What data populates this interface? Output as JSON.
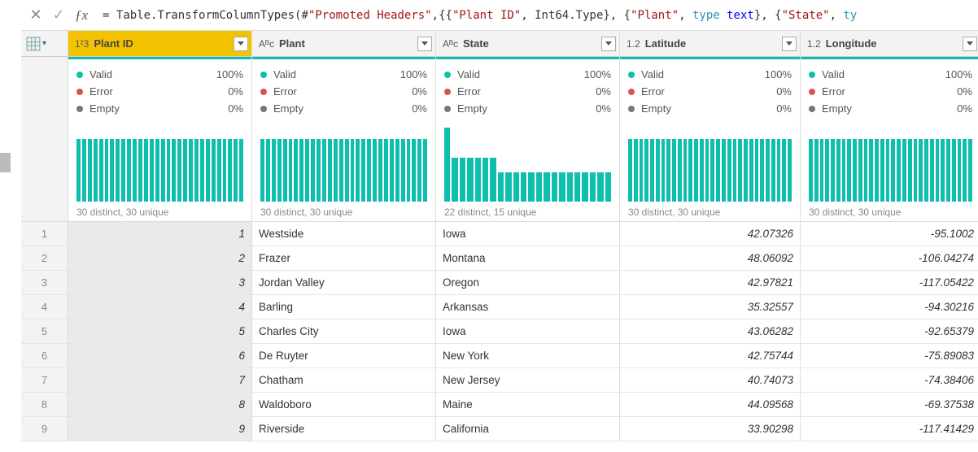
{
  "formula": {
    "prefix": "= ",
    "parts": [
      {
        "t": "plain",
        "v": "Table.TransformColumnTypes(#"
      },
      {
        "t": "str",
        "v": "\"Promoted Headers\""
      },
      {
        "t": "plain",
        "v": ",{{"
      },
      {
        "t": "str",
        "v": "\"Plant ID\""
      },
      {
        "t": "plain",
        "v": ", Int64.Type}, {"
      },
      {
        "t": "str",
        "v": "\"Plant\""
      },
      {
        "t": "plain",
        "v": ", "
      },
      {
        "t": "kw",
        "v": "type"
      },
      {
        "t": "plain",
        "v": " "
      },
      {
        "t": "type",
        "v": "text"
      },
      {
        "t": "plain",
        "v": "}, {"
      },
      {
        "t": "str",
        "v": "\"State\""
      },
      {
        "t": "plain",
        "v": ", "
      },
      {
        "t": "kw",
        "v": "ty"
      }
    ]
  },
  "stats": {
    "valid_label": "Valid",
    "error_label": "Error",
    "empty_label": "Empty",
    "pct100": "100%",
    "pct0": "0%"
  },
  "columns": [
    {
      "name": "Plant ID",
      "type_icon": "1²3",
      "selected": true,
      "align": "num",
      "dist_label": "30 distinct, 30 unique",
      "bars": "flat"
    },
    {
      "name": "Plant",
      "type_icon": "Aᴮc",
      "selected": false,
      "align": "text",
      "dist_label": "30 distinct, 30 unique",
      "bars": "flat"
    },
    {
      "name": "State",
      "type_icon": "Aᴮc",
      "selected": false,
      "align": "text",
      "dist_label": "22 distinct, 15 unique",
      "bars": "stepped"
    },
    {
      "name": "Latitude",
      "type_icon": "1.2",
      "selected": false,
      "align": "num",
      "dist_label": "30 distinct, 30 unique",
      "bars": "flat"
    },
    {
      "name": "Longitude",
      "type_icon": "1.2",
      "selected": false,
      "align": "num",
      "dist_label": "30 distinct, 30 unique",
      "bars": "flat"
    }
  ],
  "rows": [
    {
      "idx": "1",
      "cells": [
        "1",
        "Westside",
        "Iowa",
        "42.07326",
        "-95.1002"
      ]
    },
    {
      "idx": "2",
      "cells": [
        "2",
        "Frazer",
        "Montana",
        "48.06092",
        "-106.04274"
      ]
    },
    {
      "idx": "3",
      "cells": [
        "3",
        "Jordan Valley",
        "Oregon",
        "42.97821",
        "-117.05422"
      ]
    },
    {
      "idx": "4",
      "cells": [
        "4",
        "Barling",
        "Arkansas",
        "35.32557",
        "-94.30216"
      ]
    },
    {
      "idx": "5",
      "cells": [
        "5",
        "Charles City",
        "Iowa",
        "43.06282",
        "-92.65379"
      ]
    },
    {
      "idx": "6",
      "cells": [
        "6",
        "De Ruyter",
        "New York",
        "42.75744",
        "-75.89083"
      ]
    },
    {
      "idx": "7",
      "cells": [
        "7",
        "Chatham",
        "New Jersey",
        "40.74073",
        "-74.38406"
      ]
    },
    {
      "idx": "8",
      "cells": [
        "8",
        "Waldoboro",
        "Maine",
        "44.09568",
        "-69.37538"
      ]
    },
    {
      "idx": "9",
      "cells": [
        "9",
        "Riverside",
        "California",
        "33.90298",
        "-117.41429"
      ]
    }
  ],
  "chart_data": {
    "type": "table",
    "title": "Power Query Preview",
    "columns": [
      "Plant ID",
      "Plant",
      "State",
      "Latitude",
      "Longitude"
    ],
    "column_types": [
      "Int64",
      "text",
      "text",
      "decimal",
      "decimal"
    ],
    "rows": [
      [
        1,
        "Westside",
        "Iowa",
        42.07326,
        -95.1002
      ],
      [
        2,
        "Frazer",
        "Montana",
        48.06092,
        -106.04274
      ],
      [
        3,
        "Jordan Valley",
        "Oregon",
        42.97821,
        -117.05422
      ],
      [
        4,
        "Barling",
        "Arkansas",
        35.32557,
        -94.30216
      ],
      [
        5,
        "Charles City",
        "Iowa",
        43.06282,
        -92.65379
      ],
      [
        6,
        "De Ruyter",
        "New York",
        42.75744,
        -75.89083
      ],
      [
        7,
        "Chatham",
        "New Jersey",
        40.74073,
        -74.38406
      ],
      [
        8,
        "Waldoboro",
        "Maine",
        44.09568,
        -69.37538
      ],
      [
        9,
        "Riverside",
        "California",
        33.90298,
        -117.41429
      ]
    ],
    "column_profiles": [
      {
        "valid_pct": 100,
        "error_pct": 0,
        "empty_pct": 0,
        "distinct": 30,
        "unique": 30
      },
      {
        "valid_pct": 100,
        "error_pct": 0,
        "empty_pct": 0,
        "distinct": 30,
        "unique": 30
      },
      {
        "valid_pct": 100,
        "error_pct": 0,
        "empty_pct": 0,
        "distinct": 22,
        "unique": 15
      },
      {
        "valid_pct": 100,
        "error_pct": 0,
        "empty_pct": 0,
        "distinct": 30,
        "unique": 30
      },
      {
        "valid_pct": 100,
        "error_pct": 0,
        "empty_pct": 0,
        "distinct": 30,
        "unique": 30
      }
    ]
  }
}
